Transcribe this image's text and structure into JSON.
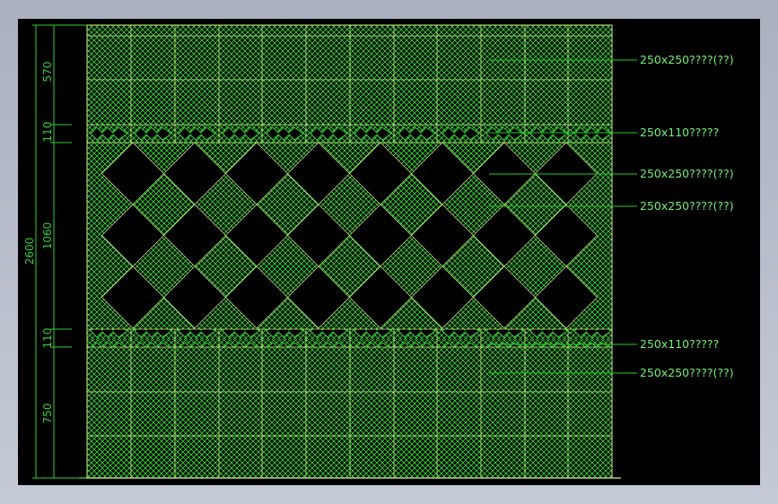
{
  "drawing": {
    "colors": {
      "background": "#000000",
      "frame": "#d8f088",
      "hatch": "#33e033",
      "tile_line": "#d8f088",
      "dimension": "#30d030",
      "leader": "#20d020",
      "label": "#70f070"
    },
    "dimensions": {
      "total": "2600",
      "segments": [
        "570",
        "110",
        "1060",
        "110",
        "750"
      ]
    },
    "labels": [
      "250x250????(??)",
      "250x110?????",
      "250x250????(??)",
      "250x250????(??)",
      "250x110?????",
      "250x250????(??)"
    ]
  }
}
